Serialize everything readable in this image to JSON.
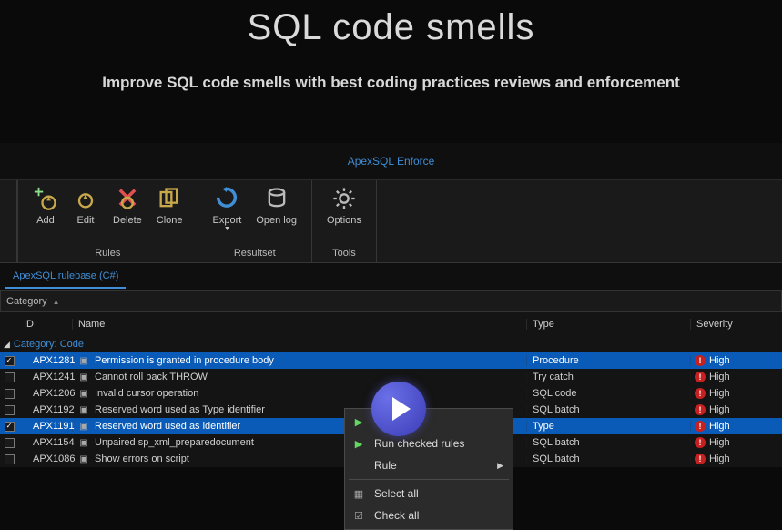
{
  "header": {
    "title": "SQL code smells",
    "subtitle": "Improve SQL code smells with best coding practices reviews and enforcement",
    "product_link": "ApexSQL Enforce"
  },
  "ribbon": {
    "groups": [
      {
        "label": "Rules",
        "buttons": [
          {
            "id": "add",
            "label": "Add"
          },
          {
            "id": "edit",
            "label": "Edit"
          },
          {
            "id": "delete",
            "label": "Delete"
          },
          {
            "id": "clone",
            "label": "Clone"
          }
        ]
      },
      {
        "label": "Resultset",
        "buttons": [
          {
            "id": "export",
            "label": "Export"
          },
          {
            "id": "openlog",
            "label": "Open log"
          }
        ]
      },
      {
        "label": "Tools",
        "buttons": [
          {
            "id": "options",
            "label": "Options"
          }
        ]
      }
    ]
  },
  "tab": {
    "active": "ApexSQL rulebase (C#)"
  },
  "group_strip": {
    "column": "Category"
  },
  "table": {
    "headers": {
      "id": "ID",
      "name": "Name",
      "type": "Type",
      "severity": "Severity"
    },
    "category_group": {
      "label": "Category:",
      "value": "Code"
    },
    "rows": [
      {
        "checked": true,
        "selected": true,
        "id": "APX1281",
        "name": "Permission is granted in procedure body",
        "type": "Procedure",
        "severity": "High"
      },
      {
        "checked": false,
        "selected": false,
        "id": "APX1241",
        "name": "Cannot roll back THROW",
        "type": "Try catch",
        "severity": "High"
      },
      {
        "checked": false,
        "selected": false,
        "id": "APX1206",
        "name": "Invalid cursor operation",
        "type": "SQL code",
        "severity": "High"
      },
      {
        "checked": false,
        "selected": false,
        "id": "APX1192",
        "name": "Reserved word used as Type identifier",
        "type": "SQL batch",
        "severity": "High"
      },
      {
        "checked": true,
        "selected": true,
        "id": "APX1191",
        "name": "Reserved word used as identifier",
        "type": "Type",
        "severity": "High"
      },
      {
        "checked": false,
        "selected": false,
        "id": "APX1154",
        "name": "Unpaired sp_xml_preparedocument",
        "type": "SQL batch",
        "severity": "High"
      },
      {
        "checked": false,
        "selected": false,
        "id": "APX1086",
        "name": "Show errors on script",
        "type": "SQL batch",
        "severity": "High"
      }
    ]
  },
  "context_menu": {
    "items": [
      {
        "id": "run-checked",
        "label": "Run checked rules",
        "icon": "play-check"
      },
      {
        "id": "rule",
        "label": "Rule",
        "icon": "",
        "submenu": true
      },
      {
        "sep": true
      },
      {
        "id": "select-all",
        "label": "Select all",
        "icon": "select-all"
      },
      {
        "id": "check-all",
        "label": "Check all",
        "icon": "check-all"
      }
    ]
  }
}
